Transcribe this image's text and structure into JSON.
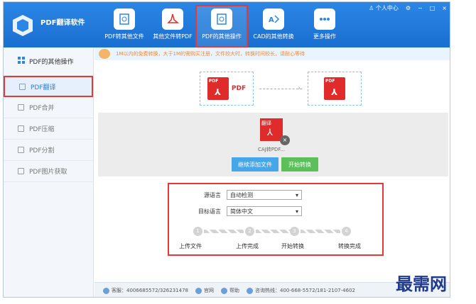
{
  "app": {
    "title": "PDF翻译软件"
  },
  "toolbar": {
    "items": [
      {
        "label": "PDF转其他文件",
        "icon": "gear-doc-icon"
      },
      {
        "label": "其他文件转PDF",
        "icon": "acrobat-icon"
      },
      {
        "label": "PDF的其他操作",
        "icon": "gear-doc-icon"
      },
      {
        "label": "CAD的其他转换",
        "icon": "cad-icon"
      },
      {
        "label": "更多操作",
        "icon": "more-dots-icon"
      }
    ]
  },
  "window_controls": {
    "user_center": "个人中心",
    "minimize": "−",
    "maximize": "□",
    "close": "×"
  },
  "sidebar": {
    "header": "PDF的其他操作",
    "items": [
      {
        "label": "PDF翻译"
      },
      {
        "label": "PDF合并"
      },
      {
        "label": "PDF压缩"
      },
      {
        "label": "PDF分割"
      },
      {
        "label": "PDF图片获取"
      }
    ]
  },
  "notice": {
    "text": "1M以内的免费转换，大于1M的需购买注册，文件较大时，转换时间较长，请耐心等待"
  },
  "flow": {
    "label": "PDF"
  },
  "file": {
    "name": "CAJ转PDF...",
    "badge": "翻译"
  },
  "buttons": {
    "add": "继续添加文件",
    "start": "开始转换"
  },
  "lang": {
    "source_label": "源语言",
    "source_value": "自动检测",
    "target_label": "目标语言",
    "target_value": "简体中文"
  },
  "steps": {
    "numbers": [
      "1",
      "2",
      "3",
      "4"
    ],
    "labels": [
      "上传文件",
      "上传完成",
      "开始转换",
      "转换完成"
    ]
  },
  "statusbar": {
    "service": "客服：4006685572/326231478",
    "website": "官网",
    "help": "帮助",
    "hotline": "咨询热线：400-668-5572/181-2107-4602"
  },
  "watermark": "最需网",
  "colors": {
    "titlebar": "#1a6fd0",
    "accent": "#2a7be4",
    "highlight": "#e53935",
    "pdf_red": "#e02b2b"
  }
}
